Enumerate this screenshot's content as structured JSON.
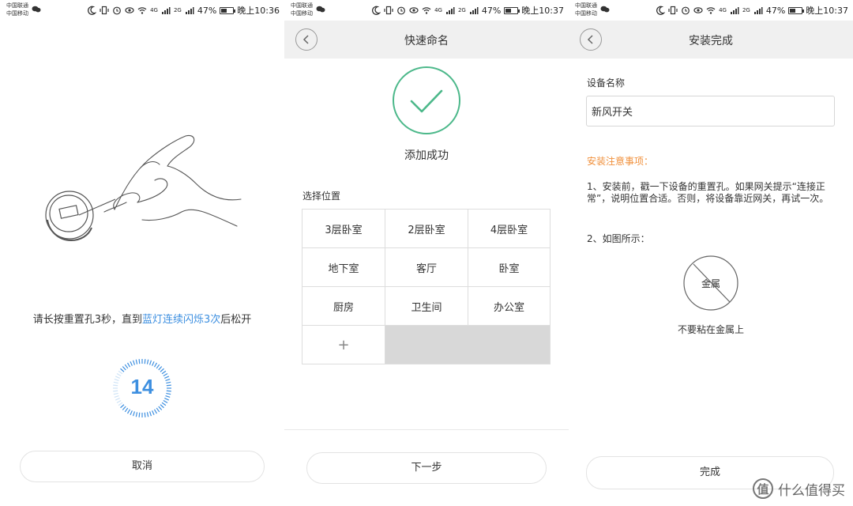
{
  "status_bars": [
    {
      "carrier1": "中国联通",
      "carrier2": "中国移动",
      "signal1": "4G",
      "signal2": "2G",
      "battery": "47%",
      "battery_level": 0.47,
      "time": "晚上10:36"
    },
    {
      "carrier1": "中国联通",
      "carrier2": "中国移动",
      "signal1": "4G",
      "signal2": "2G",
      "battery": "47%",
      "battery_level": 0.47,
      "time": "晚上10:37"
    },
    {
      "carrier1": "中国联通",
      "carrier2": "中国移动",
      "signal1": "4G",
      "signal2": "2G",
      "battery": "47%",
      "battery_level": 0.47,
      "time": "晚上10:37"
    }
  ],
  "screen1": {
    "instruction_prefix": "请长按重置孔3秒，直到",
    "instruction_highlight": "蓝灯连续闪烁3次",
    "instruction_suffix": "后松开",
    "countdown": "14",
    "highlight_color": "#3d8fe0",
    "cancel_label": "取消"
  },
  "screen2": {
    "title": "快速命名",
    "success_text": "添加成功",
    "success_color": "#4cb88a",
    "location_label": "选择位置",
    "locations": [
      "3层卧室",
      "2层卧室",
      "4层卧室",
      "地下室",
      "客厅",
      "卧室",
      "厨房",
      "卫生间",
      "办公室"
    ],
    "add_label": "+",
    "next_label": "下一步"
  },
  "screen3": {
    "title": "安装完成",
    "device_name_label": "设备名称",
    "device_name_value": "新风开关",
    "notes_title": "安装注意事项：",
    "notes_color": "#f0903c",
    "note1": "1、安装前，戳一下设备的重置孔。如果网关提示“连接正常”，说明位置合适。否则，将设备靠近网关，再试一次。",
    "note2": "2、如图所示：",
    "metal_label": "金属",
    "metal_caption": "不要粘在金属上",
    "done_label": "完成"
  },
  "watermark": {
    "logo_char": "值",
    "text": "什么值得买"
  }
}
